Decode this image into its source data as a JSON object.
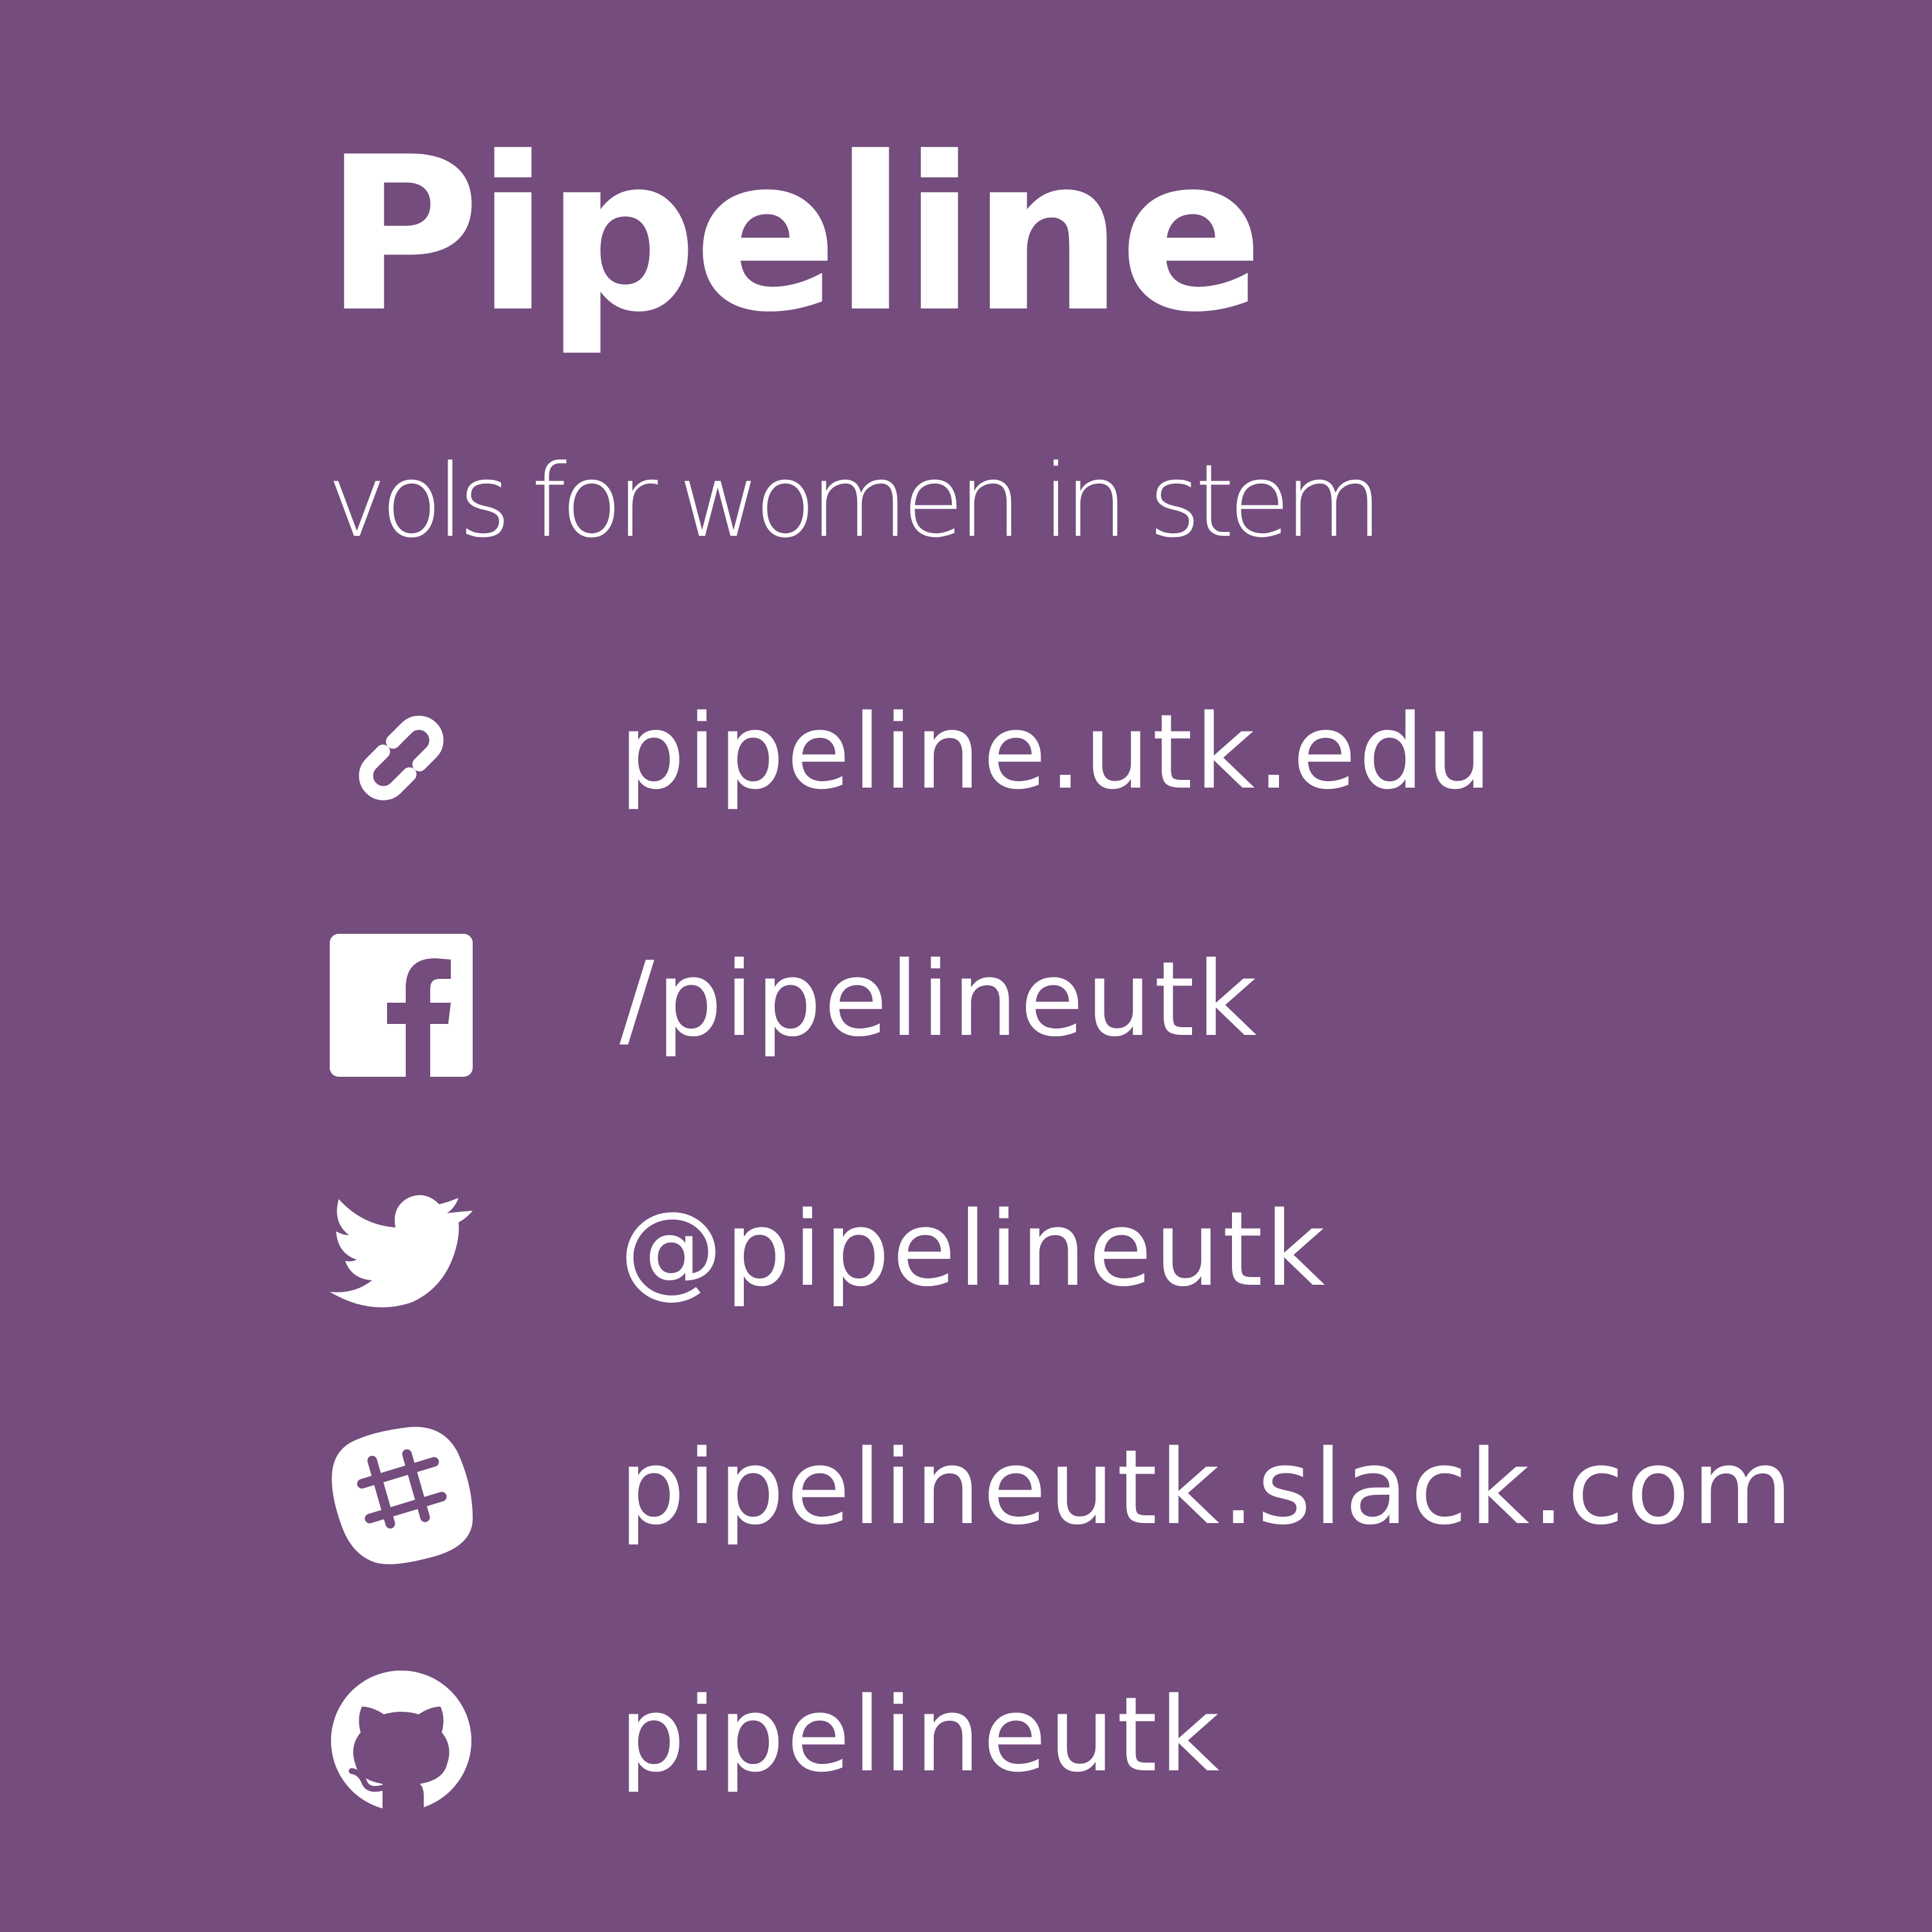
{
  "colors": {
    "background": "#744c7d",
    "foreground": "#ffffff"
  },
  "header": {
    "title": "Pipeline",
    "tagline": "vols for women in stem"
  },
  "contacts": [
    {
      "icon": "link-icon",
      "label": "pipeline.utk.edu"
    },
    {
      "icon": "facebook-icon",
      "label": "/pipelineutk"
    },
    {
      "icon": "twitter-icon",
      "label": "@pipelineutk"
    },
    {
      "icon": "slack-icon",
      "label": "pipelineutk.slack.com"
    },
    {
      "icon": "github-icon",
      "label": "pipelineutk"
    }
  ]
}
